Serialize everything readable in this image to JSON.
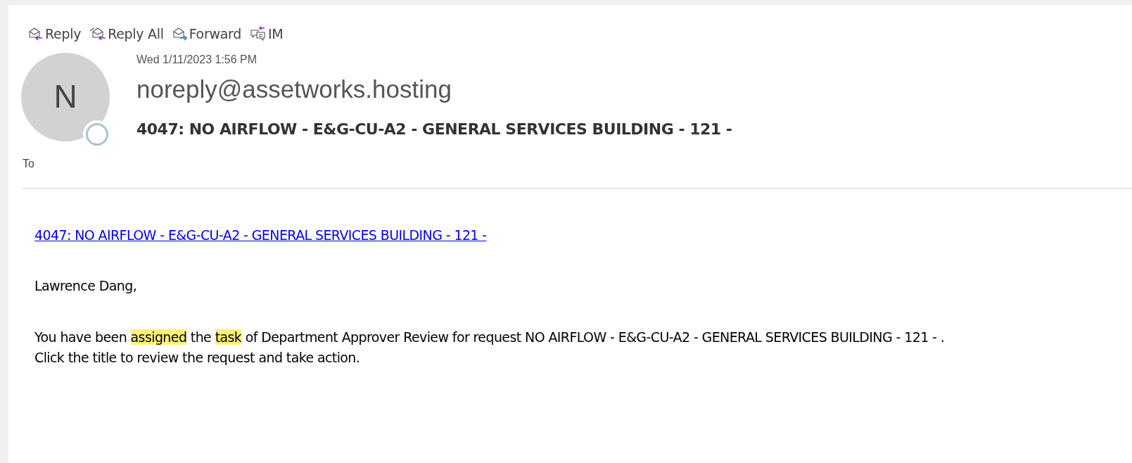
{
  "toolbar": [
    {
      "kind": "reply",
      "label": "Reply"
    },
    {
      "kind": "reply_all",
      "label": "Reply All"
    },
    {
      "kind": "forward",
      "label": "Forward"
    },
    {
      "kind": "im",
      "label": "IM"
    }
  ],
  "header": {
    "avatar_initial": "N",
    "online": false,
    "date": "Wed 1/11/2023 1:56 PM",
    "sender": "noreply@assetworks.hosting",
    "subject": "4047: NO AIRFLOW - E&G-CU-A2 - GENERAL SERVICES BUILDING - 121 -",
    "to_label": "To"
  },
  "body": {
    "link": "4047: NO AIRFLOW - E&G-CU-A2 - GENERAL SERVICES BUILDING - 121 -",
    "greeting": "Lawrence Dang,",
    "message": [
      {
        "text": "You have been ",
        "highlighted": false
      },
      {
        "text": "assigned",
        "highlighted": true
      },
      {
        "text": " the ",
        "highlighted": false
      },
      {
        "text": "task",
        "highlighted": true
      },
      {
        "text": " of Department Approver Review for request NO AIRFLOW - E&G-CU-A2 - GENERAL SERVICES BUILDING - 121 - .",
        "highlighted": false
      }
    ],
    "closing": "Click the title to review the request and take action."
  }
}
